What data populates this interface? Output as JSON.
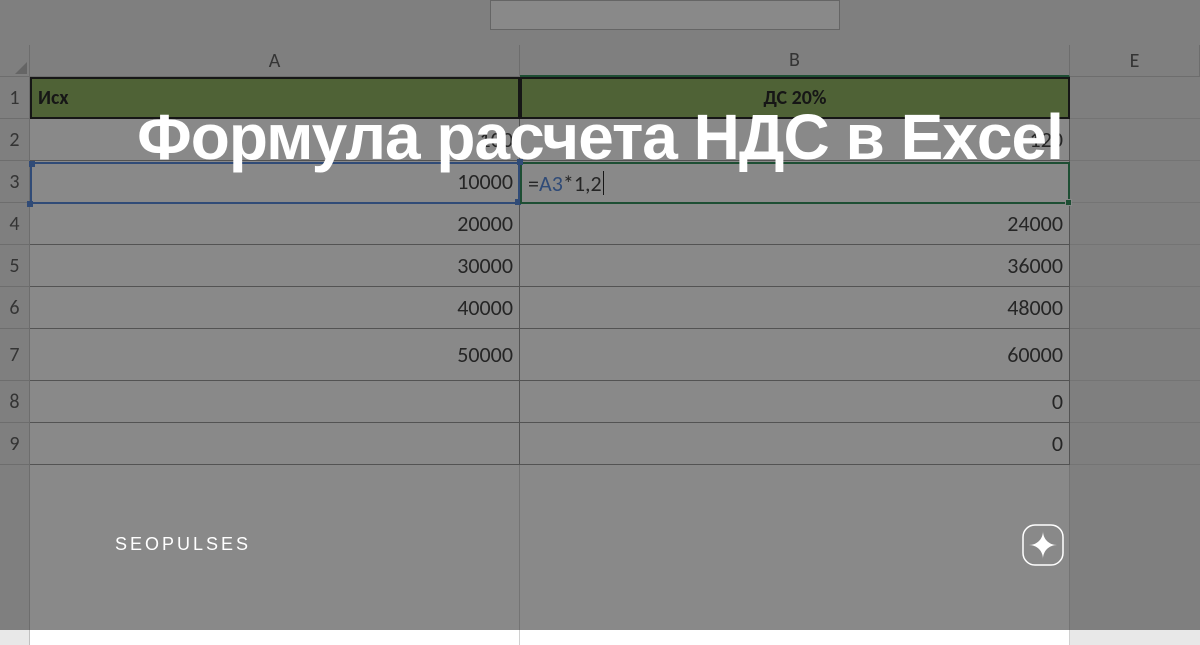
{
  "overlay": {
    "title": "Формула расчета НДС в Excel",
    "brand": "SEOPULSES"
  },
  "columns": {
    "A": "A",
    "B": "B",
    "E": "E"
  },
  "row_numbers": [
    "1",
    "2",
    "3",
    "4",
    "5",
    "6",
    "7",
    "8",
    "9"
  ],
  "headers": {
    "A": "Исх",
    "B": "ДС 20%"
  },
  "formula": {
    "prefix": "=",
    "ref": "A3",
    "rest": "*1,2"
  },
  "data": {
    "r2": {
      "A": "100",
      "B": "120"
    },
    "r3": {
      "A": "10000",
      "B": ""
    },
    "r4": {
      "A": "20000",
      "B": "24000"
    },
    "r5": {
      "A": "30000",
      "B": "36000"
    },
    "r6": {
      "A": "40000",
      "B": "48000"
    },
    "r7": {
      "A": "50000",
      "B": "60000"
    },
    "r8": {
      "A": "",
      "B": "0"
    },
    "r9": {
      "A": "",
      "B": "0"
    }
  }
}
